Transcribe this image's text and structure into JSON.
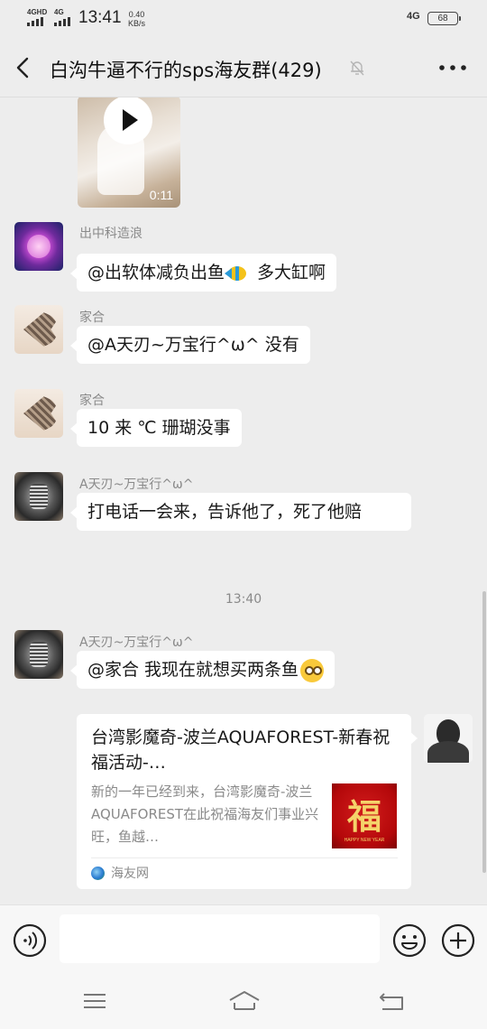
{
  "status_bar": {
    "network1": "4GHD",
    "network2": "4G",
    "time": "13:41",
    "speed_value": "0.40",
    "speed_unit": "KB/s",
    "network_right": "4G",
    "battery": "68"
  },
  "header": {
    "title": "白沟牛逼不行的sps海友群(429)"
  },
  "video": {
    "duration": "0:11"
  },
  "messages": [
    {
      "sender": "出中科造浪",
      "text": "@出软体减负出鱼",
      "text_after": " 多大缸啊"
    },
    {
      "sender": "家合",
      "text": "@A天刃~万宝行^ω^ 没有"
    },
    {
      "sender": "家合",
      "text": "10 来 ℃ 珊瑚没事"
    },
    {
      "sender": "A天刃~万宝行^ω^",
      "text": "打电话一会来，告诉他了，死了他赔"
    },
    {
      "sender": "A天刃~万宝行^ω^",
      "text": "@家合  我现在就想买两条鱼"
    }
  ],
  "timestamp": "13:40",
  "link_card": {
    "title": "台湾影魔奇-波兰AQUAFOREST-新春祝福活动-…",
    "description": "新的一年已经到来，台湾影魔奇-波兰AQUAFOREST在此祝福海友们事业兴旺，鱼越…",
    "thumb_char": "福",
    "thumb_sub": "HAPPY NEW YEAR",
    "source": "海友网"
  },
  "input": {
    "placeholder": ""
  },
  "colors": {
    "background": "#ededed",
    "bubble": "#ffffff",
    "secondary_text": "#8a8a8a"
  }
}
